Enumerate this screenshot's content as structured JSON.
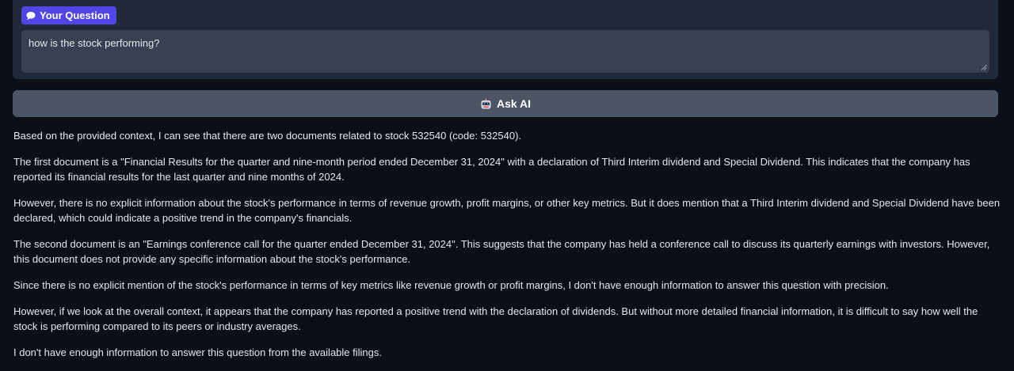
{
  "question_panel": {
    "badge_label": "Your Question",
    "badge_icon": "chat-bubble-icon",
    "textarea_value": "how is the stock performing?"
  },
  "ask_button": {
    "label": "Ask AI",
    "icon": "robot-icon"
  },
  "answer": {
    "paragraphs": [
      "Based on the provided context, I can see that there are two documents related to stock 532540 (code: 532540).",
      "The first document is a \"Financial Results for the quarter and nine-month period ended December 31, 2024\" with a declaration of Third Interim dividend and Special Dividend. This indicates that the company has reported its financial results for the last quarter and nine months of 2024.",
      "However, there is no explicit information about the stock's performance in terms of revenue growth, profit margins, or other key metrics. But it does mention that a Third Interim dividend and Special Dividend have been declared, which could indicate a positive trend in the company's financials.",
      "The second document is an \"Earnings conference call for the quarter ended December 31, 2024\". This suggests that the company has held a conference call to discuss its quarterly earnings with investors. However, this document does not provide any specific information about the stock's performance.",
      "Since there is no explicit mention of the stock's performance in terms of key metrics like revenue growth or profit margins, I don't have enough information to answer this question with precision.",
      "However, if we look at the overall context, it appears that the company has reported a positive trend with the declaration of dividends. But without more detailed financial information, it is difficult to say how well the stock is performing compared to its peers or industry averages.",
      "I don't have enough information to answer this question from the available filings."
    ]
  },
  "colors": {
    "page_background": "#0b0f19",
    "panel_background": "#1f2937",
    "textarea_background": "#374151",
    "badge_background": "#4f46e5",
    "button_background": "#4b5563",
    "text": "#e5e7eb"
  }
}
